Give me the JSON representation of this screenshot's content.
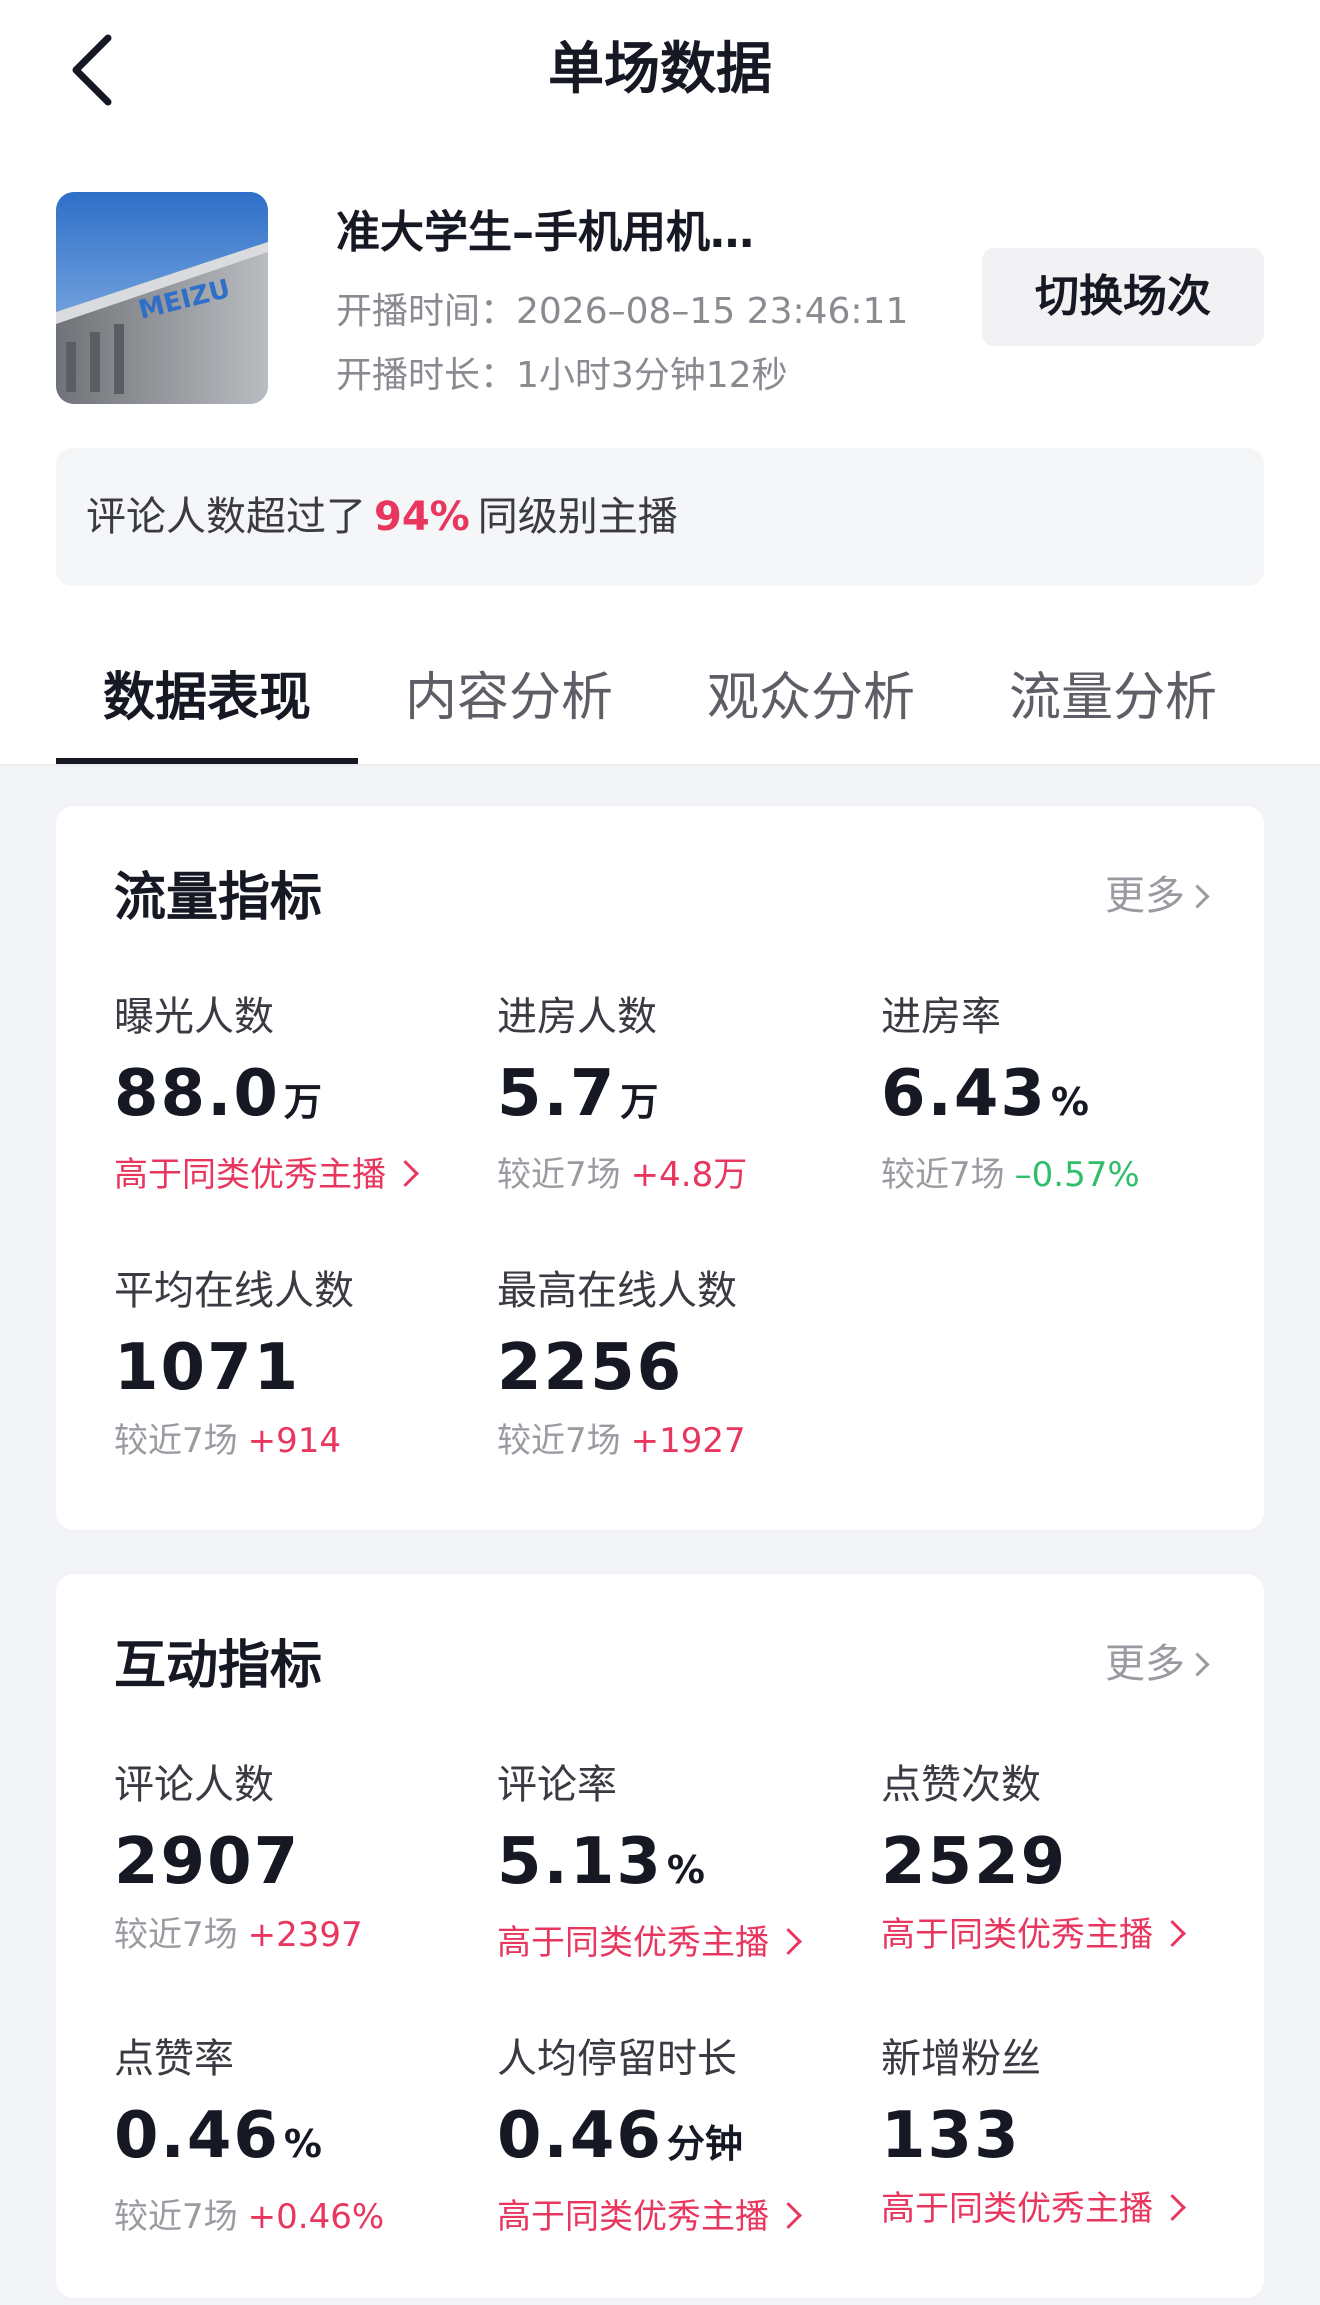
{
  "header": {
    "title": "单场数据"
  },
  "live": {
    "title": "准大学生–手机用机…",
    "thumbnail_text": "MEIZU",
    "start_time": "开播时间：2026–08–15 23:46:11",
    "duration": "开播时长：1小时3分钟12秒",
    "switch_label": "切换场次"
  },
  "rank": {
    "prefix": "评论人数超过了",
    "percent": "94%",
    "suffix": "同级别主播"
  },
  "tabs": [
    {
      "label": "数据表现",
      "active": true
    },
    {
      "label": "内容分析",
      "active": false
    },
    {
      "label": "观众分析",
      "active": false
    },
    {
      "label": "流量分析",
      "active": false
    }
  ],
  "traffic": {
    "title": "流量指标",
    "more": "更多",
    "metrics": [
      {
        "label": "曝光人数",
        "value": "88.0",
        "unit": "万",
        "excellent": "高于同类优秀主播"
      },
      {
        "label": "进房人数",
        "value": "5.7",
        "unit": "万",
        "compare": "较近7场",
        "delta": "+4.8万"
      },
      {
        "label": "进房率",
        "value": "6.43",
        "unit": "%",
        "compare": "较近7场",
        "delta": "–0.57%"
      },
      {
        "label": "平均在线人数",
        "value": "1071",
        "compare": "较近7场",
        "delta": "+914"
      },
      {
        "label": "最高在线人数",
        "value": "2256",
        "compare": "较近7场",
        "delta": "+1927"
      }
    ]
  },
  "interaction": {
    "title": "互动指标",
    "more": "更多",
    "metrics": [
      {
        "label": "评论人数",
        "value": "2907",
        "compare": "较近7场",
        "delta": "+2397"
      },
      {
        "label": "评论率",
        "value": "5.13",
        "unit": "%",
        "excellent": "高于同类优秀主播"
      },
      {
        "label": "点赞次数",
        "value": "2529",
        "excellent": "高于同类优秀主播"
      },
      {
        "label": "点赞率",
        "value": "0.46",
        "unit": "%",
        "compare": "较近7场",
        "delta": "+0.46%"
      },
      {
        "label": "人均停留时长",
        "value": "0.46",
        "unit": "分钟",
        "excellent": "高于同类优秀主播"
      },
      {
        "label": "新增粉丝",
        "value": "133",
        "excellent": "高于同类优秀主播"
      }
    ]
  },
  "colors": {
    "accent_red": "#e8365e",
    "positive_green": "#2fbe6a",
    "text_primary": "#161823",
    "text_secondary": "#9a9ba1"
  }
}
